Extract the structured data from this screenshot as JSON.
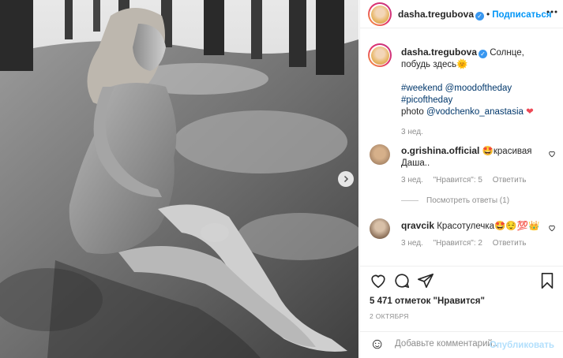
{
  "post": {
    "author": "dasha.tregubova",
    "follow_label": "Подписаться",
    "dot": "•"
  },
  "caption": {
    "author": "dasha.tregubova",
    "text": "Солнце, побудь здесь🌞",
    "tags_line1": "#weekend @moodoftheday",
    "tags_line2": "#picoftheday",
    "photo_prefix": "photo ",
    "photo_credit": "@vodchenko_anastasia",
    "heart": "❤",
    "time": "3 нед."
  },
  "comments": [
    {
      "author": "o.grishina.official",
      "text": "🤩красивая Даша..",
      "time": "3 нед.",
      "likes": "\"Нравится\": 5",
      "reply": "Ответить",
      "view_replies": "Посмотреть ответы (1)"
    },
    {
      "author": "qravcik",
      "text": "Красотулечка🤩😌💯👑",
      "time": "3 нед.",
      "likes": "\"Нравится\": 2",
      "reply": "Ответить"
    }
  ],
  "actions": {
    "icons": [
      "heart-icon",
      "comment-icon",
      "share-icon",
      "bookmark-icon"
    ]
  },
  "likes_text": "5 471 отметок \"Нравится\"",
  "date": "2 ОКТЯБРЯ",
  "comment_box": {
    "emoji": "☺",
    "placeholder": "Добавьте комментарий...",
    "publish": "Опубликовать"
  },
  "colors": {
    "accent": "#0095f6",
    "link": "#00376b",
    "heart": "#ed4956",
    "muted": "#8e8e8e"
  }
}
